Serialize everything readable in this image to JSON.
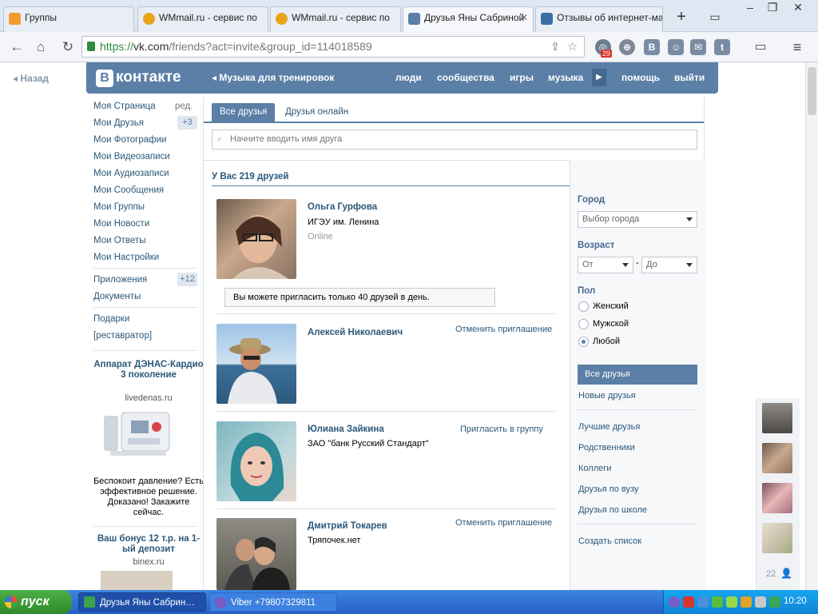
{
  "browser": {
    "tabs": [
      {
        "title": "Группы",
        "icon": "odnoklassniki-icon",
        "color": "#f29b2e"
      },
      {
        "title": "WMmail.ru - сервис по",
        "icon": "wmmail-icon",
        "color": "#e8a317"
      },
      {
        "title": "WMmail.ru - сервис по",
        "icon": "wmmail-icon",
        "color": "#e8a317"
      },
      {
        "title": "Друзья Яны Сабриной",
        "icon": "vk-icon",
        "color": "#5b7fa6"
      },
      {
        "title": "Отзывы об интернет-ма",
        "icon": "cart-icon",
        "color": "#3a6ea5"
      }
    ],
    "url_scheme": "https://",
    "url_host": "vk.com",
    "url_path": "/friends?act=invite&group_id=114018589",
    "badge_count": "29"
  },
  "page": {
    "back_label": "Назад",
    "logo_text": "контакте",
    "logo_letter": "В",
    "music_label": "Музыка для тренировок",
    "top_nav": [
      "люди",
      "сообщества",
      "игры",
      "музыка",
      "помощь",
      "выйти"
    ]
  },
  "left_menu": {
    "items": [
      {
        "label": "Моя Страница",
        "extra": "ред."
      },
      {
        "label": "Мои Друзья",
        "count": "+3"
      },
      {
        "label": "Мои Фотографии"
      },
      {
        "label": "Мои Видеозаписи"
      },
      {
        "label": "Мои Аудиозаписи"
      },
      {
        "label": "Мои Сообщения"
      },
      {
        "label": "Мои Группы"
      },
      {
        "label": "Мои Новости"
      },
      {
        "label": "Мои Ответы"
      },
      {
        "label": "Мои Настройки"
      }
    ],
    "items2": [
      {
        "label": "Приложения",
        "count": "+12"
      },
      {
        "label": "Документы"
      }
    ],
    "items3": [
      {
        "label": "Подарки"
      },
      {
        "label": "[реставратор]"
      }
    ],
    "ad1": {
      "title": "Аппарат ДЭНАС-Кардио 3 поколение",
      "domain": "livedenas.ru",
      "text": "Беспокоит давление? Есть эффективное решение. Доказано! Закажите сейчас."
    },
    "ad2": {
      "title": "Ваш бонус 12 т.р. на 1-ый депозит",
      "domain": "binex.ru"
    }
  },
  "friends": {
    "tabs": [
      "Все друзья",
      "Друзья онлайн"
    ],
    "search_placeholder": "Начните вводить имя друга",
    "count_text": "У Вас 219 друзей",
    "notice": "Вы можете пригласить только 40 друзей в день.",
    "list": [
      {
        "name": "Ольга Гурфова",
        "info": "ИГЭУ им. Ленина",
        "status": "Online",
        "action": ""
      },
      {
        "name": "Алексей Николаевич",
        "info": "",
        "status": "",
        "action": "Отменить приглашение"
      },
      {
        "name": "Юлиана Зайкина",
        "info": "ЗАО \"банк Русский Стандарт\"",
        "status": "",
        "action": "Пригласить в группу"
      },
      {
        "name": "Дмитрий Токарев",
        "info": "Тряпочек.нет",
        "status": "",
        "action": "Отменить приглашение"
      }
    ]
  },
  "filters": {
    "city_label": "Город",
    "city_value": "Выбор города",
    "age_label": "Возраст",
    "age_from": "От",
    "age_sep": "-",
    "age_to": "До",
    "sex_label": "Пол",
    "sex_options": [
      "Женский",
      "Мужской",
      "Любой"
    ],
    "sex_selected": 2,
    "lists": [
      "Все друзья",
      "Новые друзья",
      "Лучшие друзья",
      "Родственники",
      "Коллеги",
      "Друзья по вузу",
      "Друзья по школе",
      "Создать список"
    ]
  },
  "chat": {
    "online_count": "22"
  },
  "taskbar": {
    "start_label": "пуск",
    "items": [
      "Друзья Яны Сабрин…",
      "Viber +79807329811"
    ],
    "clock": "10:20"
  }
}
